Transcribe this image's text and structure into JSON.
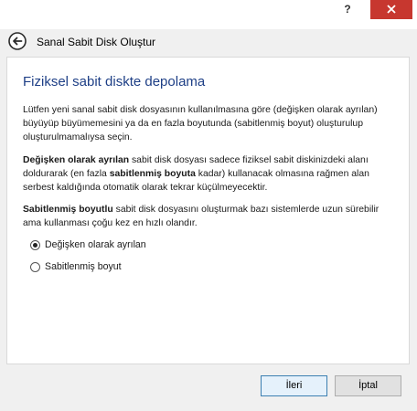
{
  "window": {
    "help_label": "?",
    "close_label": "x"
  },
  "wizard": {
    "title": "Sanal Sabit Disk Oluştur"
  },
  "page": {
    "heading": "Fiziksel sabit diskte depolama",
    "intro": "Lütfen yeni sanal sabit disk dosyasının kullanılmasına göre (değişken olarak ayrılan) büyüyüp büyümemesini ya da en fazla boyutunda (sabitlenmiş boyut) oluşturulup oluşturulmamalıysa seçin.",
    "dynamic_title": "Değişken olarak ayrılan",
    "dynamic_text_a": " sabit disk dosyası sadece fiziksel sabit diskinizdeki alanı doldurarak (en fazla ",
    "dynamic_bold": "sabitlenmiş boyuta",
    "dynamic_text_b": " kadar) kullanacak olmasına rağmen alan serbest kaldığında otomatik olarak tekrar küçülmeyecektir.",
    "fixed_title": "Sabitlenmiş boyutlu",
    "fixed_text": " sabit disk dosyasını oluşturmak bazı sistemlerde uzun sürebilir ama kullanması çoğu kez en hızlı olandır."
  },
  "options": [
    {
      "label": "Değişken olarak ayrılan",
      "selected": true
    },
    {
      "label": "Sabitlenmiş boyut",
      "selected": false
    }
  ],
  "buttons": {
    "next": "İleri",
    "cancel": "İptal"
  }
}
